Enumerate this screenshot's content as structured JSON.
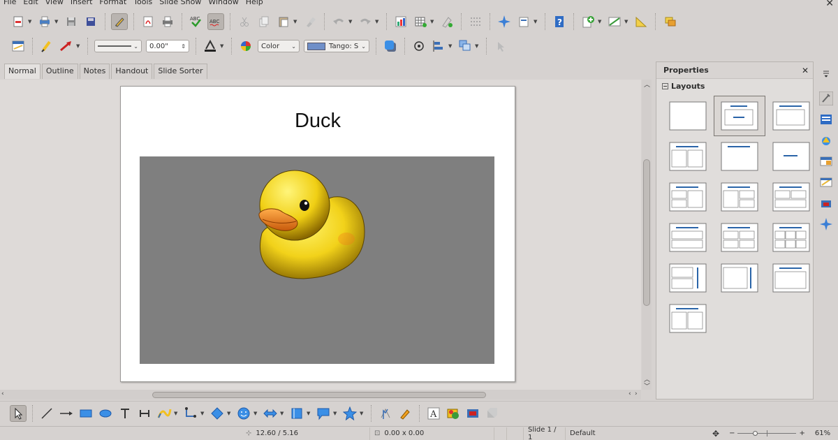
{
  "menu": [
    "File",
    "Edit",
    "View",
    "Insert",
    "Format",
    "Tools",
    "Slide Show",
    "Window",
    "Help"
  ],
  "toolbar2": {
    "line_width": "0.00\"",
    "area_style": "Color",
    "fill_color_name": "Tango: S",
    "fill_swatch": "#6f8fc8"
  },
  "view_tabs": [
    "Normal",
    "Outline",
    "Notes",
    "Handout",
    "Slide Sorter"
  ],
  "active_tab": "Normal",
  "slide": {
    "title": "Duck"
  },
  "sidebar": {
    "title": "Properties",
    "section": "Layouts",
    "layouts": [
      "blank",
      "title-content",
      "title-only-block",
      "title-2col",
      "title-only",
      "centered-text",
      "title-2rows-left",
      "title-4blocks-a",
      "title-4blocks-b",
      "title-2rows",
      "title-4blocks",
      "title-6blocks",
      "vertical-right-2",
      "vertical-right-1",
      "title-only-b",
      "title-2col-b"
    ],
    "selected_layout": 1
  },
  "status": {
    "position": "12.60 / 5.16",
    "size": "0.00 x 0.00",
    "slide": "Slide 1 / 1",
    "master": "Default",
    "zoom_percent": "61%",
    "zoom_level": 0.61
  },
  "colors": {
    "accent": "#2a64a8",
    "duck_yellow": "#f2d21a",
    "duck_bill": "#f08a22",
    "image_bg": "#7f7f7f"
  }
}
